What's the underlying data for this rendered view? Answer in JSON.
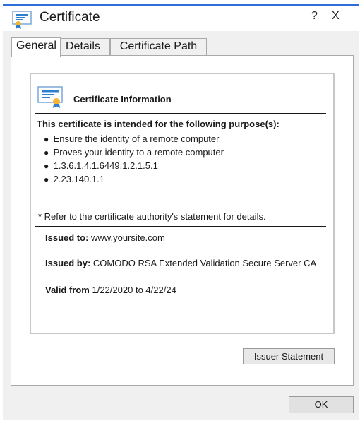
{
  "window": {
    "title": "Certificate",
    "help_label": "?",
    "close_label": "X",
    "accent_color": "#2d6fd6"
  },
  "tabs": [
    {
      "label": "General",
      "active": true
    },
    {
      "label": "Details",
      "active": false
    },
    {
      "label": "Certificate Path",
      "active": false
    }
  ],
  "info": {
    "heading": "Certificate Information",
    "purpose_heading": "This certificate is intended for the following purpose(s):",
    "purposes": [
      "Ensure the identity of a remote computer",
      "Proves your identity to a remote computer",
      "1.3.6.1.4.1.6449.1.2.1.5.1",
      "2.23.140.1.1"
    ],
    "bullet": "●",
    "refer_note": "* Refer to the certificate authority's statement for details.",
    "issued_to_label": "Issued to:",
    "issued_to_value": "www.yoursite.com",
    "issued_by_label": "Issued by:",
    "issued_by_value": "COMODO RSA Extended Validation Secure Server CA",
    "valid_from_label": "Valid from",
    "valid_from_value": "1/22/2020",
    "valid_to_label": "to",
    "valid_to_value": "4/22/24"
  },
  "buttons": {
    "issuer_statement": "Issuer Statement",
    "ok": "OK"
  },
  "icons": {
    "title_icon": "certificate-icon",
    "info_icon": "certificate-icon"
  }
}
